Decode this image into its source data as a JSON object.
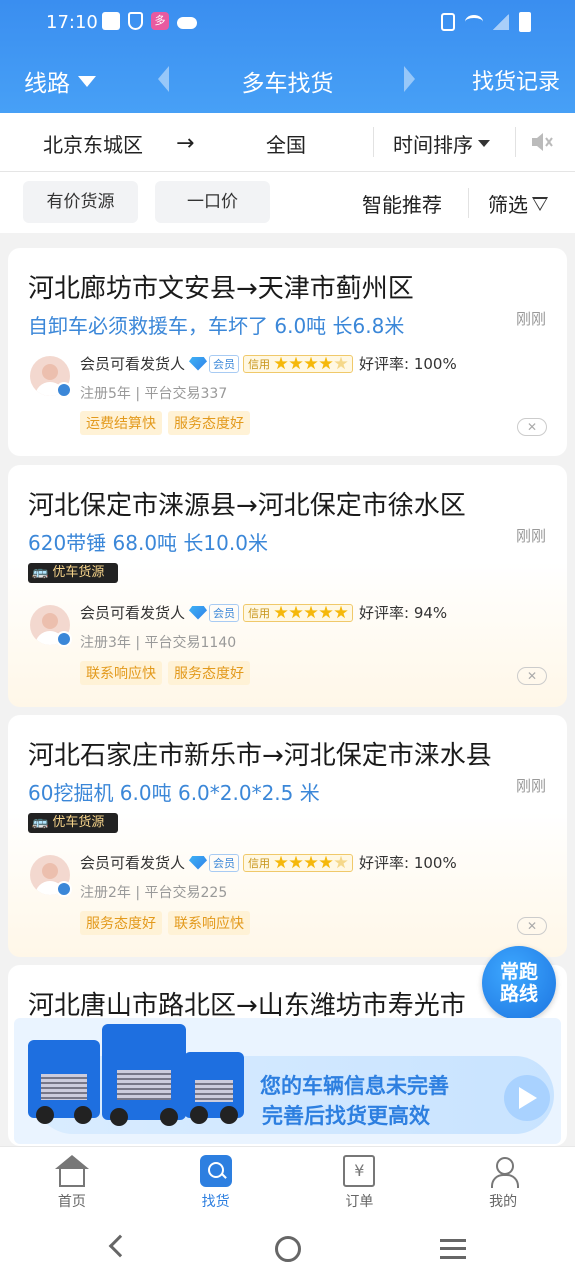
{
  "status_bar": {
    "time": "17:10",
    "app_badge": "多",
    "icons_left": [
      "mail-icon",
      "shield-icon",
      "app-icon",
      "cloud-icon"
    ],
    "icons_right": [
      "vibrate-icon",
      "wifi-icon",
      "signal-icon",
      "battery-icon"
    ]
  },
  "header": {
    "route_label": "线路",
    "title": "多车找货",
    "records_label": "找货记录",
    "bg_color": "#3a8ef0"
  },
  "filter": {
    "from": "北京东城区",
    "arrow": "→",
    "to": "全国",
    "sort": "时间排序",
    "chip1": "有价货源",
    "chip2": "一口价",
    "smart": "智能推荐",
    "screen": "筛选"
  },
  "cards": [
    {
      "route": "河北廊坊市文安县→天津市蓟州区",
      "time": "刚刚",
      "cargo": "自卸车必须救援车，车坏了 6.0吨 长6.8米",
      "premium": false,
      "shipper": "会员可看发货人",
      "member": "会员",
      "credit": "信用",
      "stars": 4,
      "rating": "好评率: 100%",
      "meta": "注册5年 | 平台交易337",
      "tags": [
        "运费结算快",
        "服务态度好"
      ]
    },
    {
      "route": "河北保定市涞源县→河北保定市徐水区",
      "time": "刚刚",
      "cargo": "620带锤 68.0吨 长10.0米",
      "premium": true,
      "premium_label": "优车货源",
      "shipper": "会员可看发货人",
      "member": "会员",
      "credit": "信用",
      "stars": 5,
      "rating": "好评率: 94%",
      "meta": "注册3年 | 平台交易1140",
      "tags": [
        "联系响应快",
        "服务态度好"
      ]
    },
    {
      "route": "河北石家庄市新乐市→河北保定市涞水县",
      "time": "刚刚",
      "cargo": "60挖掘机 6.0吨 6.0*2.0*2.5 米",
      "premium": true,
      "premium_label": "优车货源",
      "shipper": "会员可看发货人",
      "member": "会员",
      "credit": "信用",
      "stars": 4,
      "rating": "好评率: 100%",
      "meta": "注册2年 | 平台交易225",
      "tags": [
        "服务态度好",
        "联系响应快"
      ]
    },
    {
      "route": "河北唐山市路北区→山东潍坊市寿光市"
    }
  ],
  "float_button": {
    "line1": "常跑",
    "line2": "路线"
  },
  "banner": {
    "line1": "您的车辆信息未完善",
    "line2": "完善后找货更高效"
  },
  "tabs": [
    {
      "label": "首页",
      "icon": "home-icon"
    },
    {
      "label": "找货",
      "icon": "search-icon",
      "active": true
    },
    {
      "label": "订单",
      "icon": "order-icon",
      "glyph": "¥"
    },
    {
      "label": "我的",
      "icon": "profile-icon"
    }
  ]
}
